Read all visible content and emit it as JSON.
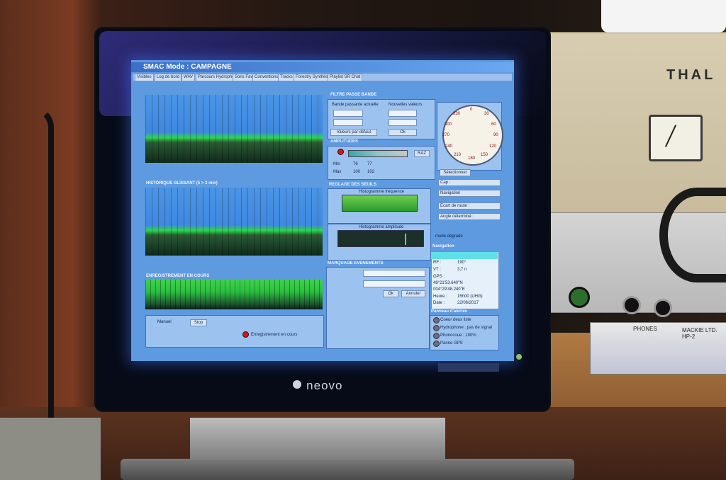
{
  "monitor": {
    "brand": "neovo"
  },
  "rack": {
    "brand": "THAL",
    "phones_label": "PHONES",
    "interface_brand": "MACKIE LTD. HP-2"
  },
  "app": {
    "title": "SMAC Mode : CAMPAGNE",
    "tabs": [
      "Visibles",
      "Log de bord",
      "WAV",
      "Parcours Hydrophone",
      "Sons Fav",
      "Conventions",
      "Tracks",
      "Forestry Synthèse",
      "Playlist SR Chat"
    ]
  },
  "panels": {
    "filter": {
      "heading": "FILTRE PASSE BANDE",
      "current_label": "Bande passante actuelle",
      "new_label": "Nouvelles valeurs",
      "default_button": "Valeurs par défaut",
      "ok_button": "Ok"
    },
    "amplitude": {
      "heading": "AMPLITUDES",
      "min_label": "Min",
      "max_label": "Max",
      "min_a": "76",
      "min_b": "77",
      "max_a": "100",
      "max_b": "102",
      "raz_button": "RAZ"
    },
    "thresholds": {
      "heading": "REGLAGE DES SEUILS",
      "freq_histogram": "Histogramme fréquence",
      "amp_histogram": "Histogramme amplitude"
    },
    "events": {
      "heading": "MARQUAGE EVENEMENTS",
      "ok_button": "Ok",
      "cancel_button": "Annuler"
    },
    "history": {
      "heading": "HISTORIQUE GLISSANT (5 > 3 min)"
    },
    "recording": {
      "heading": "ENREGISTREMENT EN COURS",
      "manual_label": "Manuel",
      "stop_button": "Stop",
      "status": "Enregistrement en cours"
    },
    "compass": {
      "labels": [
        "0",
        "30",
        "60",
        "90",
        "120",
        "150",
        "180",
        "210",
        "240",
        "270",
        "300",
        "330"
      ],
      "select_button": "Sélectionner"
    },
    "nav_fields": [
      "Cap :",
      "Navigation",
      "Ecart de route :",
      "Angle déterminé :"
    ],
    "mode_label": "mode dégradé",
    "navigation": {
      "heading": "Navigation",
      "rows": [
        "RF :",
        "VT :",
        "GPS :",
        "48°21'53.640\"N",
        "004°29'48.240\"E",
        "Heure :",
        "Date :"
      ],
      "rf_value": "190°",
      "vt_value": "3,7 n",
      "time_value": "15h00 (UHG)",
      "date_value": "22/06/2017"
    },
    "alerts": {
      "heading": "Panneau d'alertes",
      "items": [
        "Coeur deux liste",
        "Hydrophone : pas de signal",
        "Phonocoue : 100%",
        "Panne GPS"
      ]
    }
  }
}
